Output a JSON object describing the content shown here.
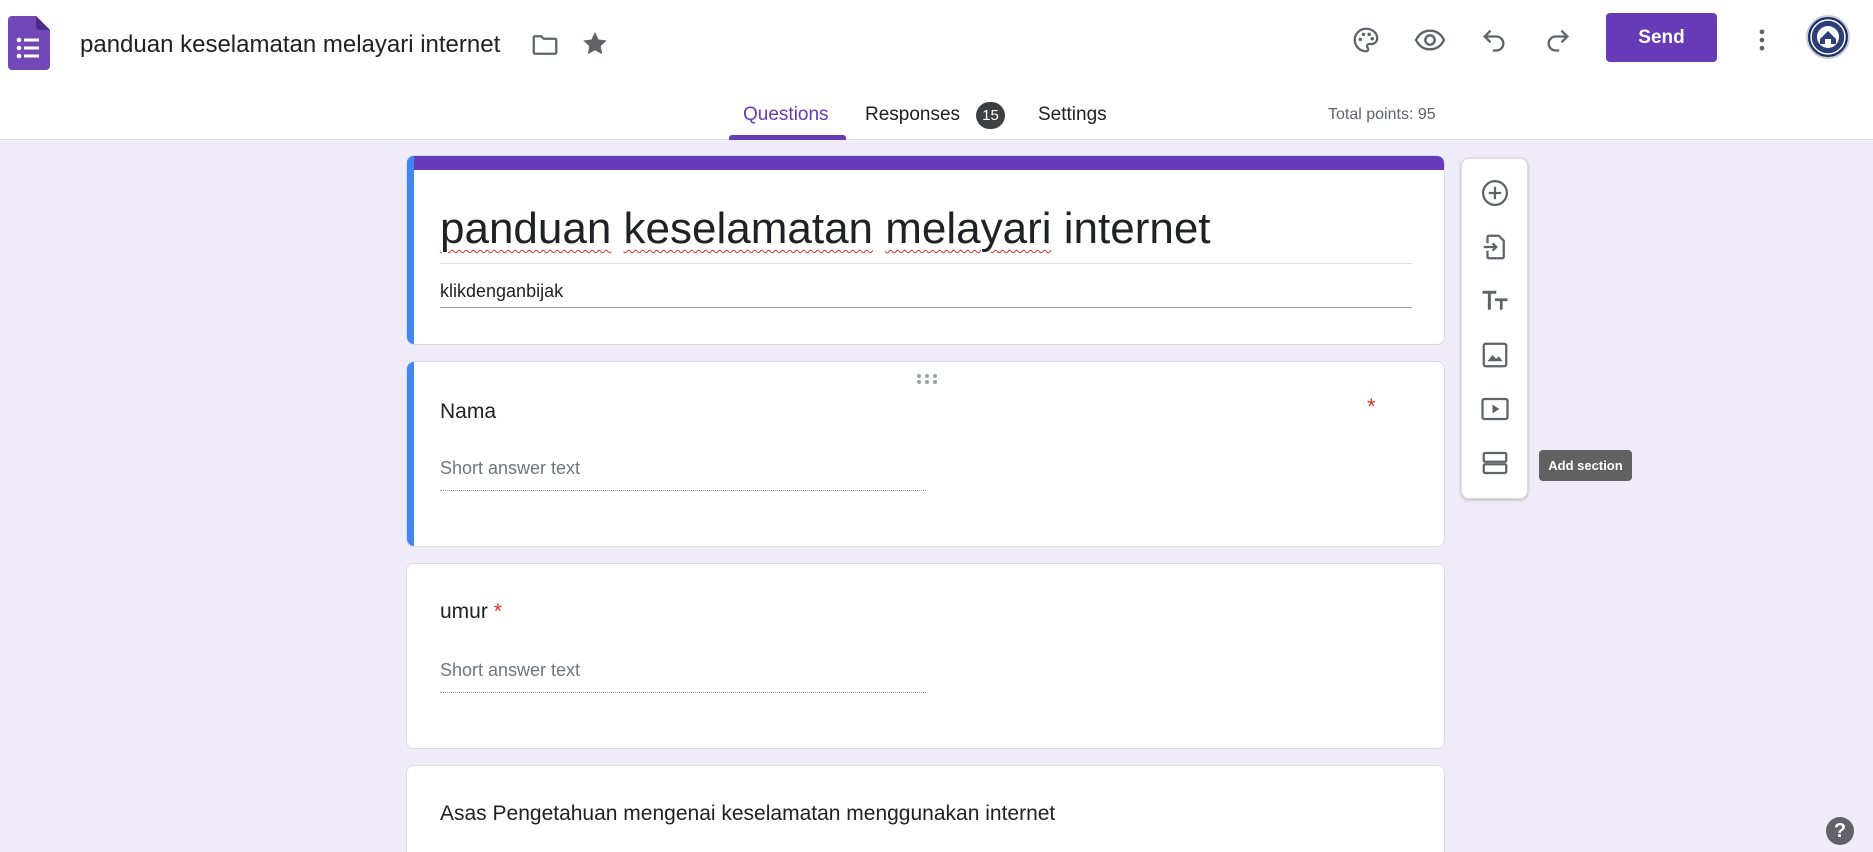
{
  "header": {
    "doc_title": "panduan keselamatan melayari internet",
    "send_label": "Send"
  },
  "tabs": [
    {
      "label": "Questions",
      "active": true
    },
    {
      "label": "Responses",
      "badge": "15"
    },
    {
      "label": "Settings"
    }
  ],
  "total_points": "Total points: 95",
  "form": {
    "title_words": [
      "panduan",
      " ",
      "keselamatan",
      " ",
      "melayari",
      " internet"
    ],
    "description": "klikdenganbijak"
  },
  "questions": [
    {
      "title": "Nama",
      "required_marker": "*",
      "placeholder": "Short answer text"
    },
    {
      "title": "umur",
      "required_marker": "*",
      "placeholder": "Short answer text"
    },
    {
      "title": "Asas Pengetahuan mengenai keselamatan menggunakan internet"
    }
  ],
  "tooltip": "Add section",
  "help": "?",
  "colors": {
    "accent": "#673ab7",
    "focus_bar": "#4285f4",
    "required": "#d93025",
    "background": "#f0ebf8"
  },
  "icons": [
    "forms-logo-icon",
    "folder-icon",
    "star-icon",
    "palette-icon",
    "eye-icon",
    "undo-icon",
    "redo-icon",
    "more-vert-icon",
    "add-circle-icon",
    "import-icon",
    "title-text-icon",
    "image-icon",
    "video-icon",
    "section-icon",
    "help-icon"
  ]
}
